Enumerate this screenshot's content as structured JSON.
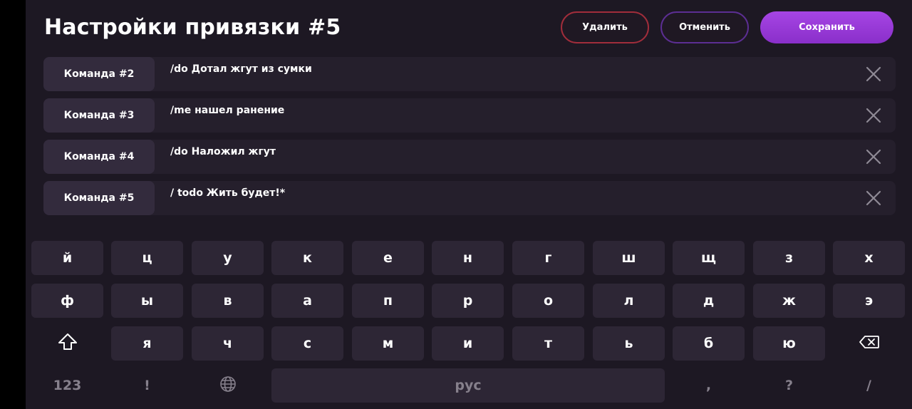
{
  "header": {
    "title": "Настройки привязки #5",
    "delete_label": "Удалить",
    "cancel_label": "Отменить",
    "save_label": "Сохранить"
  },
  "commands": [
    {
      "label": "Команда #2",
      "value": "/do Дотал жгут из сумки"
    },
    {
      "label": "Команда #3",
      "value": "/me нашел ранение"
    },
    {
      "label": "Команда #4",
      "value": "/do Наложил жгут"
    },
    {
      "label": "Команда #5",
      "value": "/ todo Жить будет!*"
    }
  ],
  "keyboard": {
    "row1": [
      "й",
      "ц",
      "у",
      "к",
      "е",
      "н",
      "г",
      "ш",
      "щ",
      "з",
      "х"
    ],
    "row2": [
      "ф",
      "ы",
      "в",
      "а",
      "п",
      "р",
      "о",
      "л",
      "д",
      "ж",
      "э"
    ],
    "row3": [
      "я",
      "ч",
      "с",
      "м",
      "и",
      "т",
      "ь",
      "б",
      "ю"
    ],
    "numbers_label": "123",
    "exclaim": "!",
    "space_label": "рус",
    "comma": ",",
    "question": "?",
    "slash": "/"
  },
  "colors": {
    "background": "#1d1823",
    "accent": "#9a3ddc",
    "delete_border": "#a12d3b",
    "cancel_border": "#5c2e93"
  },
  "icons": {
    "clear": "close-icon",
    "shift": "shift-icon",
    "backspace": "backspace-icon",
    "language": "globe-icon"
  }
}
